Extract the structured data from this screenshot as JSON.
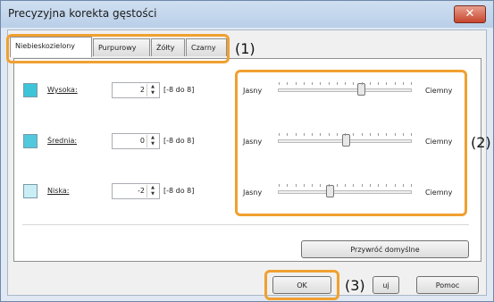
{
  "window": {
    "title": "Precyzyjna korekta gęstości",
    "close_label": "✕"
  },
  "tabs": [
    {
      "label": "Niebieskozielony",
      "active": true
    },
    {
      "label": "Purpurowy",
      "active": false
    },
    {
      "label": "Żółty",
      "active": false
    },
    {
      "label": "Czarny",
      "active": false
    }
  ],
  "rows": [
    {
      "label": "Wysoka:",
      "value": "2",
      "range": "[-8 do 8]",
      "color": "#3ec4d8",
      "slider_value": 2
    },
    {
      "label": "Średnia:",
      "value": "0",
      "range": "[-8 do 8]",
      "color": "#52c8dc",
      "slider_value": 0
    },
    {
      "label": "Niska:",
      "value": "-2",
      "range": "[-8 do 8]",
      "color": "#c9eef6",
      "slider_value": -2
    }
  ],
  "slider": {
    "left_label": "Jasny",
    "right_label": "Ciemny",
    "min": -8,
    "max": 8
  },
  "buttons": {
    "restore": "Przywróć domyślne",
    "ok": "OK",
    "cancel": "uj",
    "help": "Pomoc"
  },
  "callouts": {
    "c1": "(1)",
    "c2": "(2)",
    "c3": "(3)"
  },
  "colors": {
    "callout": "#f0a030"
  }
}
